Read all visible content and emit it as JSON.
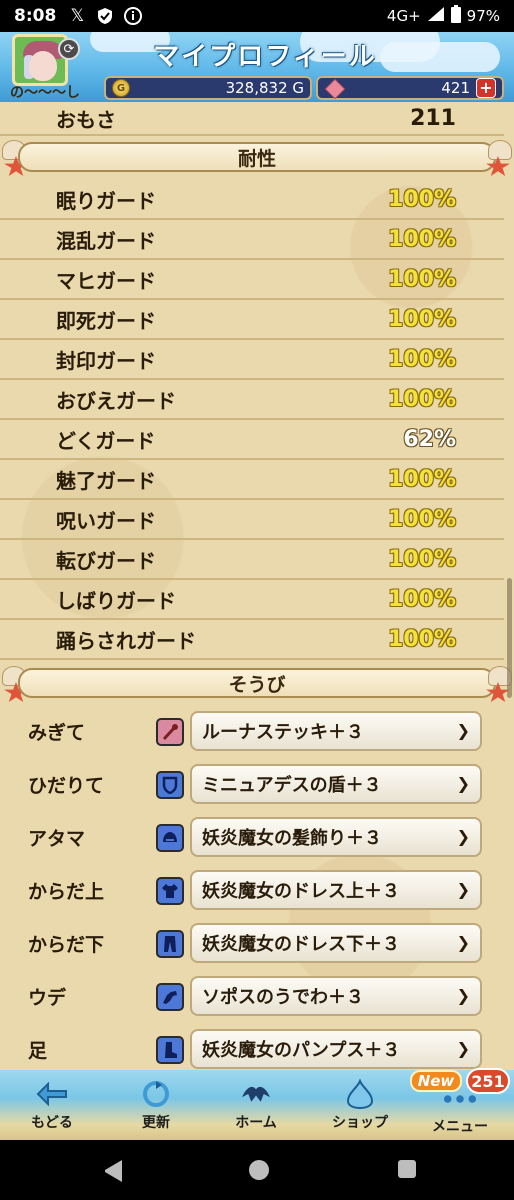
{
  "status_bar": {
    "time": "8:08",
    "network": "4G+",
    "battery": "97%"
  },
  "header": {
    "title": "マイプロフィール",
    "username": "の〜〜〜し",
    "gold": "328,832 G",
    "gems": "421",
    "gold_icon": "G",
    "plus": "+"
  },
  "weight": {
    "label": "おもさ",
    "value": "211"
  },
  "resistance": {
    "title": "耐性",
    "items": [
      {
        "label": "眠りガード",
        "value": "100%"
      },
      {
        "label": "混乱ガード",
        "value": "100%"
      },
      {
        "label": "マヒガード",
        "value": "100%"
      },
      {
        "label": "即死ガード",
        "value": "100%"
      },
      {
        "label": "封印ガード",
        "value": "100%"
      },
      {
        "label": "おびえガード",
        "value": "100%"
      },
      {
        "label": "どくガード",
        "value": "62%"
      },
      {
        "label": "魅了ガード",
        "value": "100%"
      },
      {
        "label": "呪いガード",
        "value": "100%"
      },
      {
        "label": "転びガード",
        "value": "100%"
      },
      {
        "label": "しばりガード",
        "value": "100%"
      },
      {
        "label": "踊らされガード",
        "value": "100%"
      }
    ]
  },
  "equipment": {
    "title": "そうび",
    "items": [
      {
        "slot": "みぎて",
        "item": "ルーナステッキ＋３",
        "icon": "staff-icon",
        "color": "#c0392b"
      },
      {
        "slot": "ひだりて",
        "item": "ミニュアデスの盾＋３",
        "icon": "shield-icon",
        "color": "#2c4fb5"
      },
      {
        "slot": "アタマ",
        "item": "妖炎魔女の髪飾り＋３",
        "icon": "helmet-icon",
        "color": "#2c4fb5"
      },
      {
        "slot": "からだ上",
        "item": "妖炎魔女のドレス上＋３",
        "icon": "shirt-icon",
        "color": "#2c4fb5"
      },
      {
        "slot": "からだ下",
        "item": "妖炎魔女のドレス下＋３",
        "icon": "pants-icon",
        "color": "#2c4fb5"
      },
      {
        "slot": "ウデ",
        "item": "ソポスのうでわ＋３",
        "icon": "arm-icon",
        "color": "#2c4fb5"
      },
      {
        "slot": "足",
        "item": "妖炎魔女のパンプス＋３",
        "icon": "boot-icon",
        "color": "#2c4fb5"
      }
    ]
  },
  "bottom_nav": {
    "items": [
      {
        "label": "もどる",
        "icon": "back-arrow-icon"
      },
      {
        "label": "更新",
        "icon": "refresh-icon"
      },
      {
        "label": "ホーム",
        "icon": "home-dragon-icon"
      },
      {
        "label": "ショップ",
        "icon": "shop-slime-icon"
      },
      {
        "label": "メニュー",
        "icon": "menu-dots-icon"
      }
    ],
    "new_badge": "New",
    "count_badge": "251"
  }
}
